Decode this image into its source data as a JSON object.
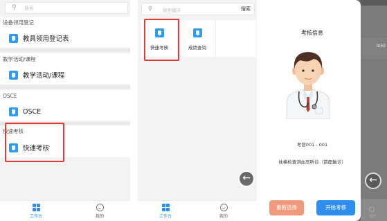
{
  "screen1": {
    "search_placeholder": "搜索",
    "sections": [
      {
        "title": "设备领用登记",
        "item": "教具领用登记表"
      },
      {
        "title": "教学活动/课程",
        "item": "教学活动/课程"
      },
      {
        "title": "OSCE",
        "item": "OSCE"
      },
      {
        "title": "快速考核",
        "item": "快速考核"
      }
    ],
    "tabs": [
      {
        "label": "工作台",
        "icon": "grid-icon",
        "active": true
      },
      {
        "label": "我的",
        "icon": "user-icon",
        "active": false
      }
    ]
  },
  "screen2": {
    "search_placeholder": "搜索模块",
    "search_button": "搜索",
    "tiles": [
      {
        "label": "快速考核",
        "icon": "hand-icon"
      },
      {
        "label": "成绩查询",
        "icon": "hand-icon"
      }
    ],
    "tabs": [
      {
        "label": "工作台",
        "icon": "grid-icon",
        "active": true
      },
      {
        "label": "我的",
        "icon": "user-icon",
        "active": false
      }
    ],
    "fab_icon": "back-arrow-icon"
  },
  "screen3": {
    "title": "考核信息",
    "examinee": "考官001 - 001",
    "task": "体格检查测血压听诊（前面触诊）",
    "buttons": {
      "reselect": "重新选择",
      "start": "开始考核"
    },
    "background_count": "0/50",
    "background_tab_label": "我的",
    "fab_icon": "back-arrow-icon"
  },
  "colors": {
    "accent": "#2e8ef0",
    "highlight_border": "#e53935",
    "reselect_button": "#f49a7c"
  }
}
